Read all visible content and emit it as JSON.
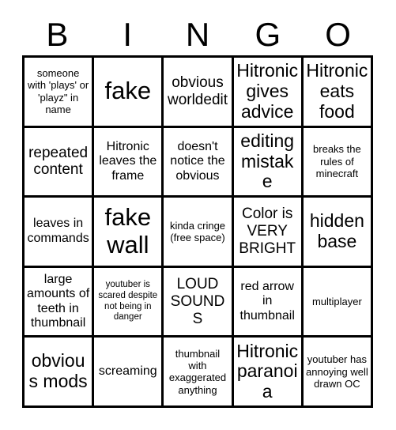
{
  "card": {
    "title_letters": [
      "B",
      "I",
      "N",
      "G",
      "O"
    ],
    "columns": 5,
    "rows": 5,
    "colors": {
      "background": "#ffffff",
      "border": "#000000",
      "text": "#000000"
    },
    "cells": [
      {
        "text": "someone with 'plays' or 'playz\" in name",
        "size": "sm"
      },
      {
        "text": "fake",
        "size": "xxl"
      },
      {
        "text": "obvious worldedit",
        "size": "lg"
      },
      {
        "text": "Hitronic gives advice",
        "size": "xl"
      },
      {
        "text": "Hitronic eats food",
        "size": "xl"
      },
      {
        "text": "repeated content",
        "size": "lg"
      },
      {
        "text": "Hitronic leaves the frame",
        "size": "md"
      },
      {
        "text": "doesn't notice the obvious",
        "size": "md"
      },
      {
        "text": "editing mistake",
        "size": "xl"
      },
      {
        "text": "breaks the rules of minecraft",
        "size": "sm"
      },
      {
        "text": "leaves in commands",
        "size": "md"
      },
      {
        "text": "fake wall",
        "size": "xxl"
      },
      {
        "text": "kinda cringe (free space)",
        "size": "sm"
      },
      {
        "text": "Color is VERY BRIGHT",
        "size": "lg"
      },
      {
        "text": "hidden base",
        "size": "xl"
      },
      {
        "text": "large amounts of teeth in thumbnail",
        "size": "md"
      },
      {
        "text": "youtuber is scared despite not being in danger",
        "size": "xs"
      },
      {
        "text": "LOUD SOUNDS",
        "size": "lg"
      },
      {
        "text": "red arrow in thumbnail",
        "size": "md"
      },
      {
        "text": "multiplayer",
        "size": "sm"
      },
      {
        "text": "obvious mods",
        "size": "xl"
      },
      {
        "text": "screaming",
        "size": "md"
      },
      {
        "text": "thumbnail with exaggerated anything",
        "size": "sm"
      },
      {
        "text": "Hitronic paranoia",
        "size": "xl"
      },
      {
        "text": "youtuber has annoying well drawn OC",
        "size": "sm"
      }
    ]
  }
}
